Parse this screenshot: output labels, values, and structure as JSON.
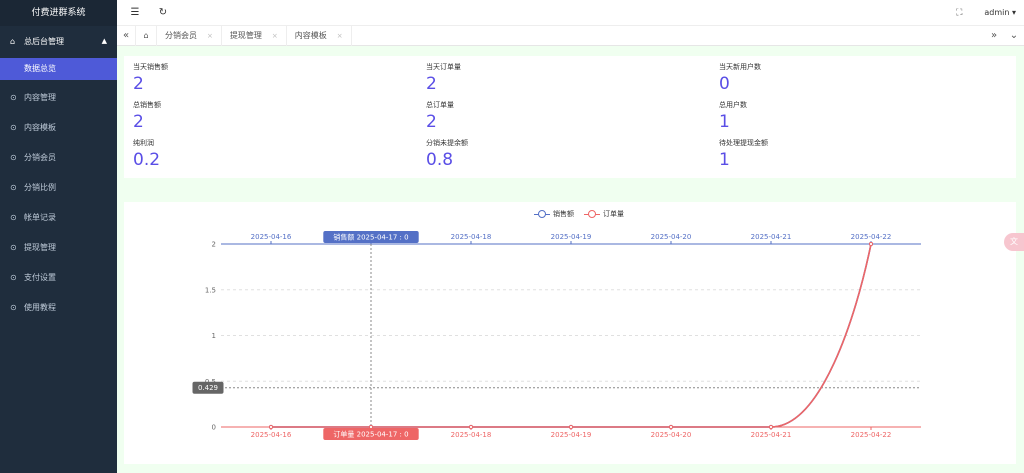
{
  "app": {
    "title": "付费进群系统"
  },
  "sidebar": {
    "group": {
      "label": "总后台管理",
      "icon": "home-icon",
      "caret": "▲"
    },
    "active_sub": "数据总览",
    "items": [
      {
        "label": "内容管理"
      },
      {
        "label": "内容模板"
      },
      {
        "label": "分销会员"
      },
      {
        "label": "分销比例"
      },
      {
        "label": "帐单记录"
      },
      {
        "label": "提现管理"
      },
      {
        "label": "支付设置"
      },
      {
        "label": "使用教程"
      }
    ]
  },
  "header": {
    "menu_icon": "☰",
    "refresh_icon": "↻",
    "fullscreen_icon": "⛶",
    "user": "admin ▾"
  },
  "tabs": {
    "left_icon": "«",
    "home_icon": "⌂",
    "items": [
      {
        "label": "分销会员",
        "close": "×"
      },
      {
        "label": "提现管理",
        "close": "×"
      },
      {
        "label": "内容模板",
        "close": "×"
      }
    ],
    "right_icon": "»",
    "dropdown_icon": "⌄"
  },
  "stats": [
    {
      "label": "当天销售额",
      "value": "2"
    },
    {
      "label": "当天订单量",
      "value": "2"
    },
    {
      "label": "当天新用户数",
      "value": "0"
    },
    {
      "label": "总销售额",
      "value": "2"
    },
    {
      "label": "总订单量",
      "value": "2"
    },
    {
      "label": "总用户数",
      "value": "1"
    },
    {
      "label": "纯利润",
      "value": "0.2"
    },
    {
      "label": "分销未提余额",
      "value": "0.8"
    },
    {
      "label": "待处理提现金额",
      "value": "1"
    }
  ],
  "chart_data": {
    "type": "line",
    "legend": [
      "销售额",
      "订单量"
    ],
    "legend_position": "top-center",
    "x": [
      "2025-04-16",
      "2025-04-17",
      "2025-04-18",
      "2025-04-19",
      "2025-04-20",
      "2025-04-21",
      "2025-04-22"
    ],
    "series": [
      {
        "name": "销售额",
        "values": [
          0,
          0,
          0,
          0,
          0,
          0,
          2
        ],
        "color": "#5470c6",
        "axis": "top"
      },
      {
        "name": "订单量",
        "values": [
          0,
          0,
          0,
          0,
          0,
          0,
          2
        ],
        "color": "#ee6666",
        "axis": "bottom"
      }
    ],
    "ylim": [
      0,
      2
    ],
    "yticks": [
      "0",
      "0.5",
      "1",
      "1.5",
      "2"
    ],
    "grid": true,
    "tooltip": {
      "top_label": "销售额  2025-04-17 : 0",
      "bottom_label": "订单量  2025-04-17 : 0",
      "y_readout": "0.429"
    }
  },
  "float_button": {
    "icon": "translate-icon",
    "glyph": "文"
  }
}
